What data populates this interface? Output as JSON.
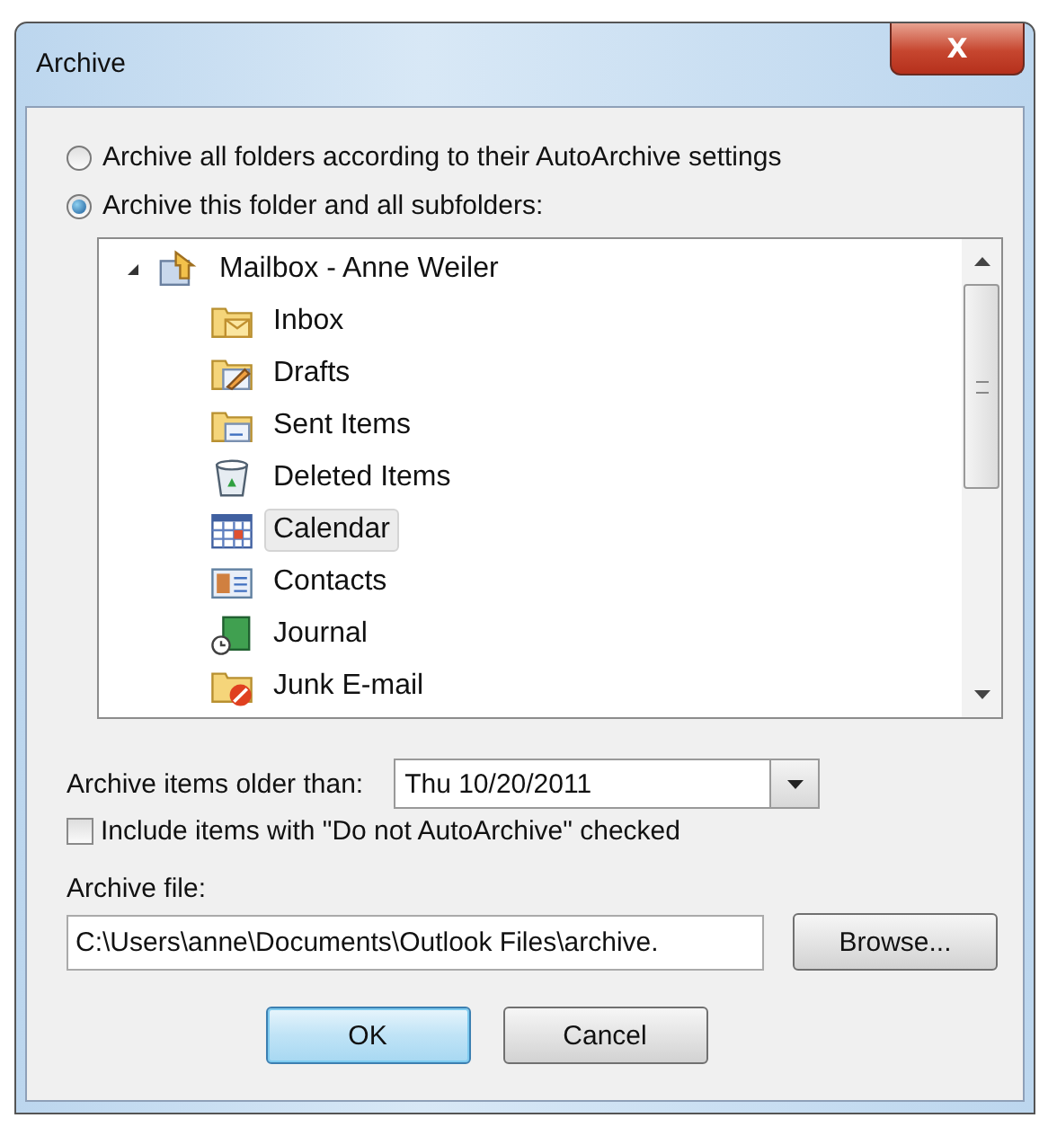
{
  "window": {
    "title": "Archive",
    "close": "X"
  },
  "options": [
    {
      "label": "Archive all folders according to their AutoArchive settings",
      "selected": false
    },
    {
      "label": "Archive this folder and all subfolders:",
      "selected": true
    }
  ],
  "tree": {
    "label": "Mailbox - Anne Weiler",
    "kind": "mailbox",
    "expanded": true,
    "children": [
      {
        "label": "Inbox",
        "kind": "inbox",
        "selected": false
      },
      {
        "label": "Drafts",
        "kind": "drafts",
        "selected": false
      },
      {
        "label": "Sent Items",
        "kind": "sent",
        "selected": false
      },
      {
        "label": "Deleted Items",
        "kind": "deleted",
        "selected": false
      },
      {
        "label": "Calendar",
        "kind": "calendar",
        "selected": true
      },
      {
        "label": "Contacts",
        "kind": "contacts",
        "selected": false
      },
      {
        "label": "Journal",
        "kind": "journal",
        "selected": false
      },
      {
        "label": "Junk E-mail",
        "kind": "junk",
        "selected": false
      }
    ]
  },
  "older_than": {
    "label": "Archive items older than:",
    "value": "Thu 10/20/2011"
  },
  "include_checkbox": {
    "label": "Include items with \"Do not AutoArchive\" checked",
    "checked": false
  },
  "archive_file": {
    "label": "Archive file:",
    "value": "C:\\Users\\anne\\Documents\\Outlook Files\\archive.",
    "browse": "Browse..."
  },
  "buttons": [
    {
      "label": "OK",
      "default": true
    },
    {
      "label": "Cancel",
      "default": false
    }
  ]
}
